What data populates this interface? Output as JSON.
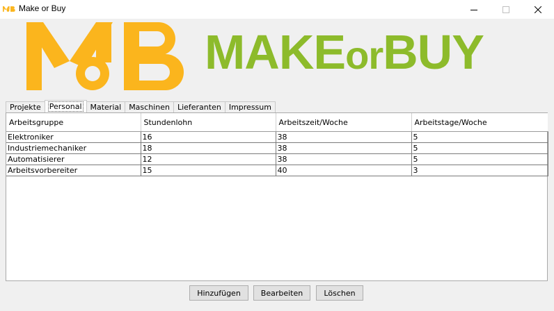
{
  "window": {
    "title": "Make or Buy",
    "controls": {
      "minimize": "minimize-icon",
      "maximize": "maximize-icon",
      "close": "close-icon"
    }
  },
  "colors": {
    "logo_orange": "#fbb51d",
    "brand_green": "#8dbb2b"
  },
  "brand": {
    "logo_text": "MoB",
    "name_part1": "MAKE",
    "name_part2": "or",
    "name_part3": "BUY"
  },
  "tabs": [
    {
      "label": "Projekte",
      "active": false
    },
    {
      "label": "Personal",
      "active": true
    },
    {
      "label": "Material",
      "active": false
    },
    {
      "label": "Maschinen",
      "active": false
    },
    {
      "label": "Lieferanten",
      "active": false
    },
    {
      "label": "Impressum",
      "active": false
    }
  ],
  "table": {
    "columns": [
      "Arbeitsgruppe",
      "Stundenlohn",
      "Arbeitszeit/Woche",
      "Arbeitstage/Woche"
    ],
    "rows": [
      [
        "Elektroniker",
        "16",
        "38",
        "5"
      ],
      [
        "Industriemechaniker",
        "18",
        "38",
        "5"
      ],
      [
        "Automatisierer",
        "12",
        "38",
        "5"
      ],
      [
        "Arbeitsvorbereiter",
        "15",
        "40",
        "3"
      ]
    ]
  },
  "buttons": {
    "add": "Hinzufügen",
    "edit": "Bearbeiten",
    "delete": "Löschen"
  }
}
